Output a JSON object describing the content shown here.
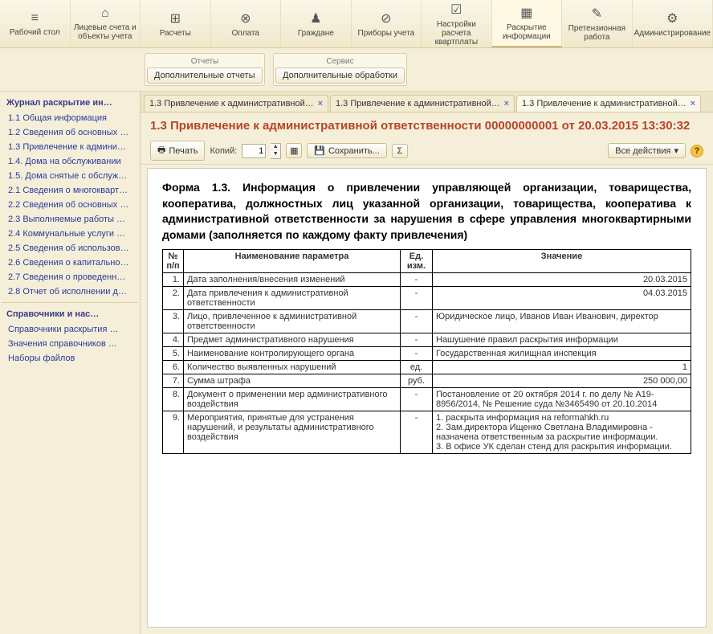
{
  "topNav": [
    {
      "label": "Рабочий стол",
      "icon": "≡"
    },
    {
      "label": "Лицевые счета и объекты учета",
      "icon": "⌂"
    },
    {
      "label": "Расчеты",
      "icon": "⊞"
    },
    {
      "label": "Оплата",
      "icon": "⊗"
    },
    {
      "label": "Граждане",
      "icon": "♟"
    },
    {
      "label": "Приборы учета",
      "icon": "⊘"
    },
    {
      "label": "Настройки расчета квартплаты",
      "icon": "☑"
    },
    {
      "label": "Раскрытие информации",
      "icon": "▦",
      "active": true
    },
    {
      "label": "Претензионная работа",
      "icon": "✎"
    },
    {
      "label": "Администрирование",
      "icon": "⚙"
    }
  ],
  "subBar": {
    "group1": {
      "title": "Отчеты",
      "btn": "Дополнительные отчеты"
    },
    "group2": {
      "title": "Сервис",
      "btn": "Дополнительные обработки"
    }
  },
  "sidebar": {
    "header1": "Журнал раскрытие ин…",
    "items1": [
      "1.1 Общая информация",
      "1.2 Сведения об основных …",
      "1.3 Привлечение к админи…",
      "1.4. Дома на обслуживании",
      "1.5. Дома снятые с обслуж…",
      "2.1 Сведения о многокварт…",
      "2.2 Сведения об основных …",
      "2.3 Выполняемые работы …",
      "2.4 Коммунальные услуги …",
      "2.5 Сведения об использов…",
      "2.6 Сведения о капитально…",
      "2.7 Сведения о проведенн…",
      "2.8 Отчет об исполнении д…"
    ],
    "header2": "Справочники и нас…",
    "items2": [
      "Справочники раскрытия …",
      "Значения справочников …",
      "Наборы файлов"
    ]
  },
  "tabs": [
    {
      "label": "1.3 Привлечение к административной отв…",
      "active": false
    },
    {
      "label": "1.3 Привлечение к административной отв…",
      "active": false
    },
    {
      "label": "1.3 Привлечение к административной отв…",
      "active": true
    }
  ],
  "docTitle": "1.3 Привлечение к административной ответственности 00000000001 от 20.03.2015 13:30:32",
  "toolbar": {
    "print": "Печать",
    "copiesLabel": "Копий:",
    "copiesValue": "1",
    "save": "Сохранить...",
    "allActions": "Все действия"
  },
  "formHeading": "Форма 1.3. Информация о привлечении управляющей организации, товарищества, кооператива, должностных лиц указанной организации, товарищества, кооператива к административной ответственности за нарушения в сфере управления многоквартирными домами (заполняется по каждому факту привлечения)",
  "table": {
    "headers": {
      "num": "№ п/п",
      "name": "Наименование параметра",
      "unit": "Ед. изм.",
      "value": "Значение"
    },
    "rows": [
      {
        "n": "1.",
        "name": "Дата заполнения/внесения изменений",
        "unit": "-",
        "value": "20.03.2015",
        "align": "right"
      },
      {
        "n": "2.",
        "name": "Дата привлечения к административной ответственности",
        "unit": "-",
        "value": "04.03.2015",
        "align": "right"
      },
      {
        "n": "3.",
        "name": "Лицо, привлеченное к административной ответственности",
        "unit": "-",
        "value": "Юридическое лицо, Иванов Иван Иванович, директор"
      },
      {
        "n": "4.",
        "name": "Предмет административного нарушения",
        "unit": "-",
        "value": "Нашушение правил раскрытия информации"
      },
      {
        "n": "5.",
        "name": "Наименование контролирующего органа",
        "unit": "-",
        "value": "Государственная жилищная инспекция"
      },
      {
        "n": "6.",
        "name": "Количество выявленных нарушений",
        "unit": "ед.",
        "value": "1",
        "align": "right"
      },
      {
        "n": "7.",
        "name": "Сумма штрафа",
        "unit": "руб.",
        "value": "250 000,00",
        "align": "right"
      },
      {
        "n": "8.",
        "name": "Документ о применении мер административного воздействия",
        "unit": "-",
        "value": "Постановление от 20 октября 2014 г. по делу № А19-8956/2014, № Решение суда №3465490 от 20.10.2014"
      },
      {
        "n": "9.",
        "name": "Мероприятия, принятые для устранения нарушений, и результаты административного воздействия",
        "unit": "-",
        "value": "1. раскрыта информация на reformahkh.ru\n2. Зам.директора Ищенко Светлана Владимировна - назначена ответственным за раскрытие информации.\n3. В офисе УК сделан стенд для раскрытия информации."
      }
    ]
  }
}
